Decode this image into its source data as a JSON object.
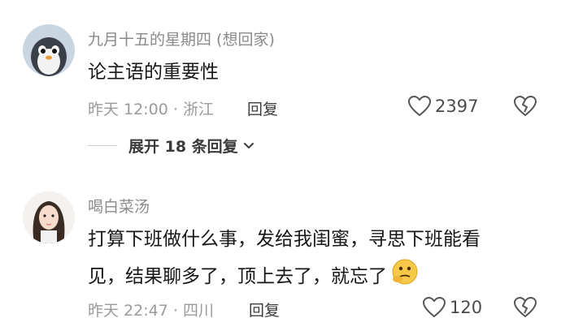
{
  "comments": [
    {
      "username": "九月十五的星期四 (想回家)",
      "content": "论主语的重要性",
      "time": "昨天 12:00",
      "location": "浙江",
      "reply_label": "回复",
      "likes": "2397",
      "avatar_icon": "penguin-avatar"
    },
    {
      "username": "喝白菜汤",
      "content_line1": "打算下班做什么事，发给我闺蜜，寻思下班能看",
      "content_line2": "见，结果聊多了，顶上去了，就忘了",
      "emoji": "thinking-face-emoji",
      "time": "昨天 22:47",
      "location": "四川",
      "reply_label": "回复",
      "likes": "120",
      "avatar_icon": "girl-avatar"
    }
  ],
  "expand_replies": {
    "label": "展开 18 条回复",
    "icon": "chevron-down-icon"
  },
  "colors": {
    "text_primary": "#161616",
    "text_secondary": "#8a8a8a",
    "background": "#ffffff"
  }
}
